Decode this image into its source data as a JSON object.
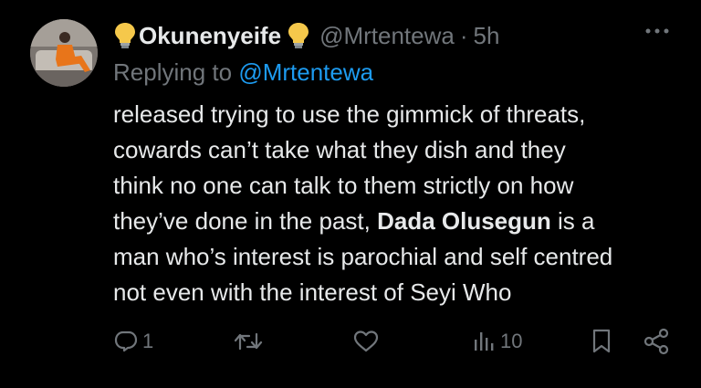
{
  "tweet": {
    "author_name": "Okunenyeife",
    "handle": "@Mrtentewa",
    "separator": "·",
    "time": "5h",
    "replying_prefix": "Replying to",
    "replying_to": "@Mrtentewa",
    "body": {
      "line1": "released trying to use the gimmick of threats,",
      "line2": "cowards can’t take what they dish and they",
      "line3": "think no one can talk to them strictly on how",
      "line4_pre": "they’ve done in the past, ",
      "line4_bold": "Dada Olusegun",
      "line4_post": " is a",
      "line5": "man who’s interest is parochial and self centred",
      "line6": "not even with the interest of Seyi Who"
    },
    "actions": {
      "reply_count": "1",
      "retweet_count": "",
      "like_count": "",
      "views_count": "10"
    }
  },
  "colors": {
    "background": "#000000",
    "text": "#e7e9ea",
    "muted": "#71767b",
    "link": "#1d9bf0",
    "bulb": "#f5c84b"
  },
  "icons": {
    "emoji": "light-bulb",
    "more": "more-horizontal-icon",
    "reply": "comment-icon",
    "retweet": "retweet-icon",
    "like": "heart-icon",
    "views": "analytics-icon",
    "bookmark": "bookmark-icon",
    "share": "share-icon"
  }
}
